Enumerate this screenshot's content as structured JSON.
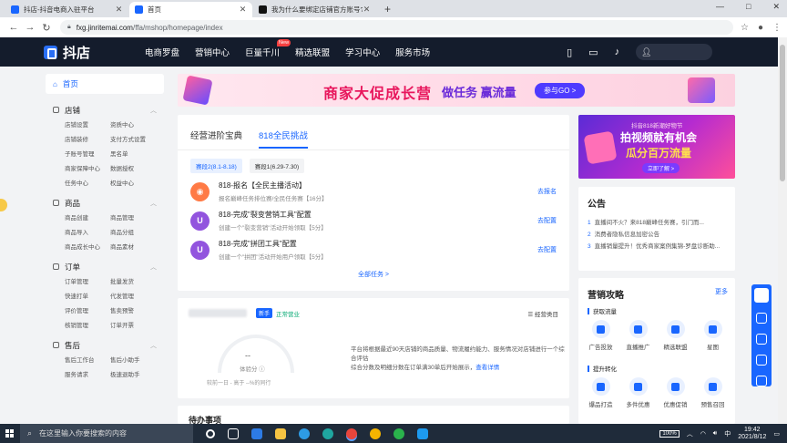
{
  "browser": {
    "tabs": [
      {
        "title": "抖店-抖音电商入驻平台",
        "favicon_color": "#1966ff"
      },
      {
        "title": "首页",
        "favicon_color": "#1966ff"
      },
      {
        "title": "我为什么要绑定店铺官方账号?",
        "favicon_color": "#111111"
      }
    ],
    "new_tab": "+",
    "url_host": "fxg.jinritemai.com",
    "url_path": "/ffa/mshop/homepage/index",
    "window_controls": [
      "—",
      "□",
      "✕"
    ]
  },
  "topnav": {
    "logo_text": "抖店",
    "menu": [
      "电商罗盘",
      "营销中心",
      "巨量千川",
      "精选联盟",
      "学习中心",
      "服务市场"
    ],
    "new_badge": "New"
  },
  "sidebar": {
    "home": "首页",
    "groups": [
      {
        "title": "店铺",
        "items": [
          "店铺设置",
          "资质中心",
          "店铺装修",
          "支付方式设置",
          "子账号管理",
          "黑名单",
          "商家保障中心",
          "数据授权",
          "任务中心",
          "权益中心"
        ]
      },
      {
        "title": "商品",
        "items": [
          "商品创建",
          "商品管理",
          "商品导入",
          "商品分组",
          "商品成长中心",
          "商品素材"
        ]
      },
      {
        "title": "订单",
        "items": [
          "订单管理",
          "批量发货",
          "快速打单",
          "代发管理",
          "评价管理",
          "售卖预警",
          "核销管理",
          "订单开票"
        ]
      },
      {
        "title": "售后",
        "items": [
          "售后工作台",
          "售后小助手",
          "服务请求",
          "极速退助手"
        ]
      }
    ]
  },
  "banner": {
    "title": "商家大促成长营",
    "subtitle": "做任务 赢流量",
    "button": "参与GO >"
  },
  "tasks_card": {
    "tabs": [
      "经营进阶宝典",
      "818全民挑战"
    ],
    "active_tab": 1,
    "chips": [
      "赛段2(8.1-8.18)",
      "赛段1(6.29-7.30)"
    ],
    "tasks": [
      {
        "title": "818-报名【全民主播活动】",
        "desc": "报名巅峰任务排位赛/全民任务赛【16分】",
        "action": "去报名",
        "icon_color": "#ff7a45"
      },
      {
        "title": "818-完成\"裂变营销工具\"配置",
        "desc": "创建一个\"裂变营销\"活动开始领取【5分】",
        "action": "去配置",
        "icon_color": "#9254de"
      },
      {
        "title": "818-完成\"拼团工具\"配置",
        "desc": "创建一个\"拼团\"活动开始用户领取【5分】",
        "action": "去配置",
        "icon_color": "#9254de"
      }
    ],
    "all_tasks": "全部任务 >"
  },
  "promo": {
    "line1": "抖音818新潮好物节",
    "line2": "拍视频就有机会",
    "line3": "瓜分百万流量",
    "button": "立即了解 >"
  },
  "notice": {
    "title": "公告",
    "items": [
      {
        "num": "1",
        "text": "直播间不火？来818巅峰任务赛，引门而..."
      },
      {
        "num": "2",
        "text": "消费者隐私信息加密公告"
      },
      {
        "num": "3",
        "text": "直播销量提升！优秀商家案例集锦-罗盘诊断助..."
      }
    ]
  },
  "marketing": {
    "title": "营销攻略",
    "more": "更多",
    "sections": [
      {
        "title": "获取流量",
        "items": [
          "广告投放",
          "直播推广",
          "精选联盟",
          "星图"
        ]
      },
      {
        "title": "提升转化",
        "items": [
          "爆品打造",
          "多件优惠",
          "优惠促销",
          "预售召回"
        ]
      }
    ]
  },
  "score_card": {
    "badge_new": "新手",
    "status": "正常营业",
    "category_link": "经营类目",
    "gauge_value": "--",
    "gauge_label": "体验分 ⓘ",
    "compare": "较前一日 -   高于 --%的同行",
    "desc1": "平台将根据最近90天店铺的商品质量、物流履约能力、服务情况对店铺进行一个综合评估",
    "desc2": "综合分数及明细分数在订单满30单后开始展示，",
    "desc_link": "查看详情"
  },
  "todo": {
    "title": "待办事项"
  },
  "taskbar": {
    "search_placeholder": "在这里输入你要搜索的内容",
    "battery": "100%",
    "ime": "中",
    "time": "19:42",
    "date": "2021/8/12"
  }
}
